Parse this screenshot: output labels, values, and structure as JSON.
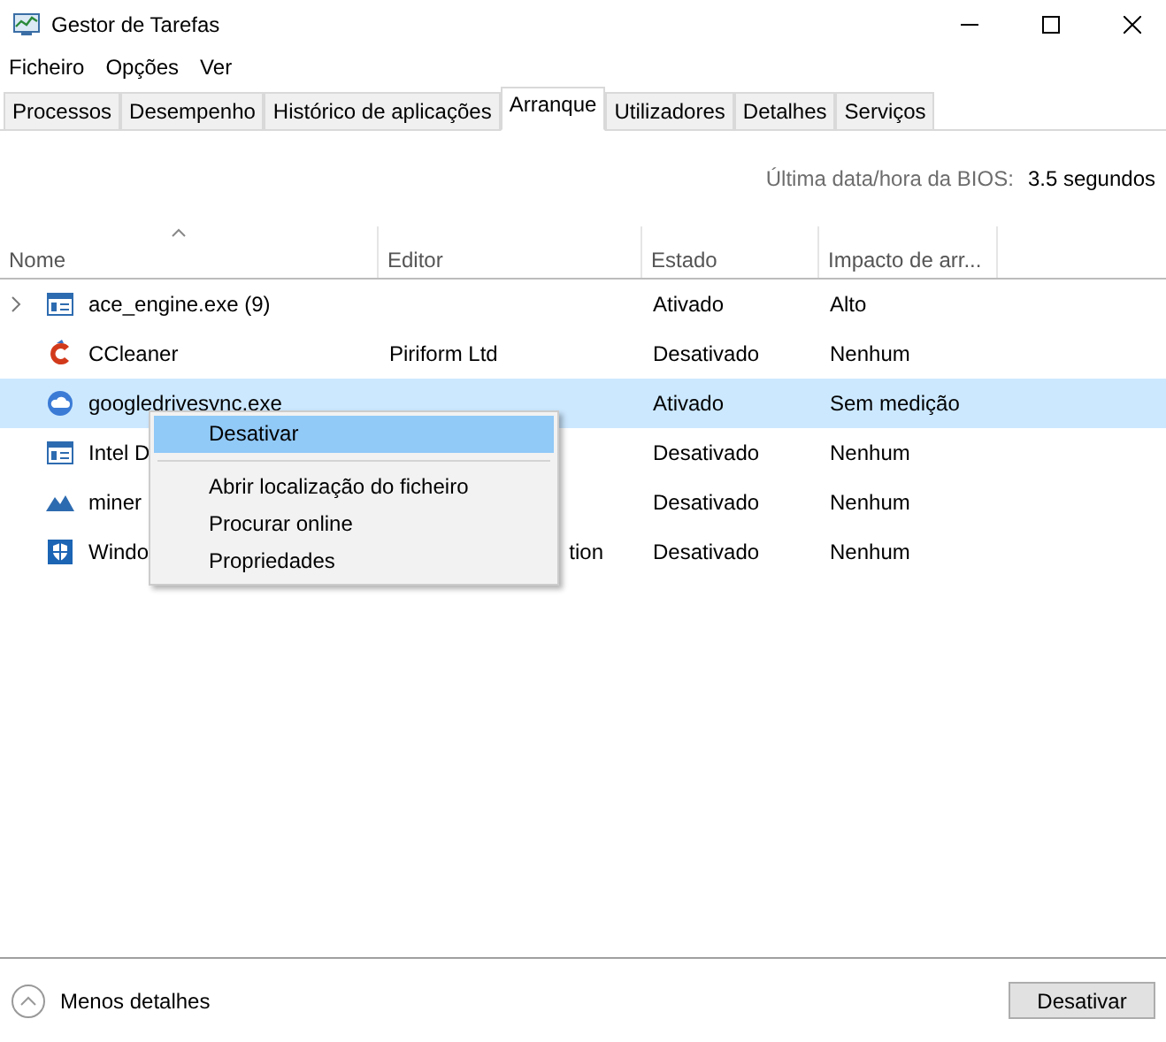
{
  "window": {
    "title": "Gestor de Tarefas"
  },
  "menu": [
    "Ficheiro",
    "Opções",
    "Ver"
  ],
  "tabs": [
    {
      "label": "Processos",
      "selected": false
    },
    {
      "label": "Desempenho",
      "selected": false
    },
    {
      "label": "Histórico de aplicações",
      "selected": false
    },
    {
      "label": "Arranque",
      "selected": true
    },
    {
      "label": "Utilizadores",
      "selected": false
    },
    {
      "label": "Detalhes",
      "selected": false
    },
    {
      "label": "Serviços",
      "selected": false
    }
  ],
  "bios": {
    "label": "Última data/hora da BIOS:",
    "value": "3.5 segundos"
  },
  "table": {
    "columns": [
      "Nome",
      "Editor",
      "Estado",
      "Impacto de arr..."
    ],
    "rows": [
      {
        "kind": "window",
        "expandable": true,
        "name": "ace_engine.exe (9)",
        "editor": "",
        "status": "Ativado",
        "impact": "Alto",
        "selected": false
      },
      {
        "kind": "ccleaner",
        "expandable": false,
        "name": "CCleaner",
        "editor": "Piriform Ltd",
        "status": "Desativado",
        "impact": "Nenhum",
        "selected": false
      },
      {
        "kind": "cloud",
        "expandable": false,
        "name": "googledrivesync.exe",
        "editor": "",
        "status": "Ativado",
        "impact": "Sem medição",
        "selected": true
      },
      {
        "kind": "window",
        "expandable": false,
        "name": "Intel D",
        "editor": "",
        "status": "Desativado",
        "impact": "Nenhum",
        "selected": false
      },
      {
        "kind": "mountain",
        "expandable": false,
        "name": "miner",
        "editor": "",
        "status": "Desativado",
        "impact": "Nenhum",
        "selected": false
      },
      {
        "kind": "shield",
        "expandable": false,
        "name": "Windo",
        "editor": "tion",
        "status": "Desativado",
        "impact": "Nenhum",
        "selected": false,
        "covered": true
      }
    ]
  },
  "context_menu": [
    {
      "label": "Desativar",
      "selected": true
    },
    {
      "label": "Abrir localização do ficheiro",
      "selected": false
    },
    {
      "label": "Procurar online",
      "selected": false
    },
    {
      "label": "Propriedades",
      "selected": false
    }
  ],
  "footer": {
    "details": "Menos detalhes",
    "button": "Desativar"
  }
}
